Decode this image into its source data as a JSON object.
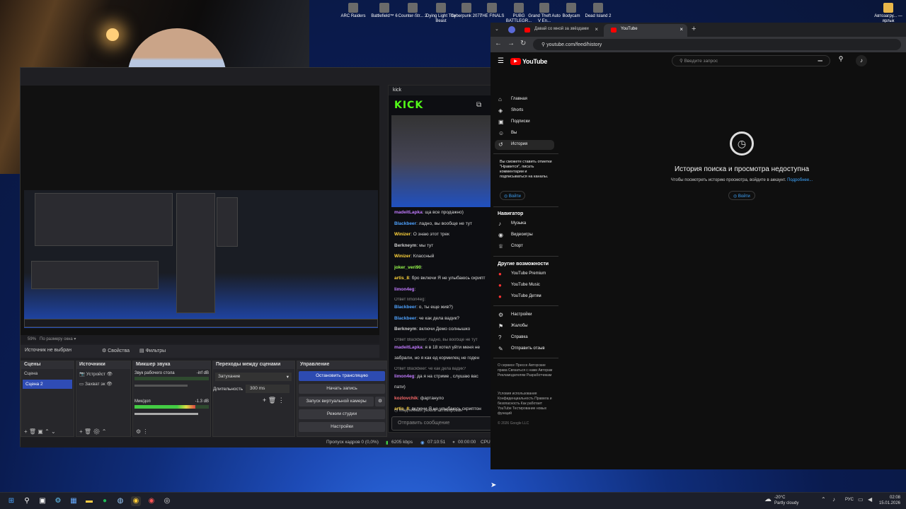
{
  "desktop_icons": [
    {
      "label": "ARC Raiders",
      "icon": "game-icon"
    },
    {
      "label": "Battlefield™ 6",
      "icon": "game-icon"
    },
    {
      "label": "Counter-Str... 2",
      "icon": "game-icon"
    },
    {
      "label": "Dying Light The Beast",
      "icon": "game-icon"
    },
    {
      "label": "Cyberpunk 2077",
      "icon": "game-icon"
    },
    {
      "label": "THE FINALS",
      "icon": "game-icon"
    },
    {
      "label": "PUBG BATTLEGR...",
      "icon": "game-icon"
    },
    {
      "label": "Grand Theft Auto V En...",
      "icon": "game-icon"
    },
    {
      "label": "Bodycam",
      "icon": "game-icon"
    },
    {
      "label": "Dead Island 2",
      "icon": "game-icon"
    },
    {
      "label": "Автозагру... — ярлык",
      "icon": "folder-icon"
    }
  ],
  "obs": {
    "zoom": "59%",
    "zoom_mode": "По размеру окна",
    "no_source": "Источник не выбран",
    "properties": "Свойства",
    "filters": "Фильтры",
    "scenes": {
      "title": "Сцены",
      "items": [
        "Сцена",
        "Сцена 2"
      ],
      "selected": 1
    },
    "sources": {
      "title": "Источники",
      "items": [
        "Устройст",
        "Захват эк"
      ]
    },
    "mixer": {
      "title": "Микшер звука",
      "channels": [
        {
          "name": "Звук рабочего стола",
          "db": "-inf dB",
          "level": 0.0
        },
        {
          "name": "Мик/доп",
          "db": "-1.3 dB",
          "level": 0.82
        }
      ]
    },
    "transitions": {
      "title": "Переходы между сценами",
      "type": "Затухание",
      "duration_label": "Длительность",
      "duration": "300 ms"
    },
    "controls": {
      "title": "Управление",
      "buttons": [
        "Остановить трансляцию",
        "Начать запись",
        "Запуск виртуальной камеры",
        "Режим студии",
        "Настройки"
      ]
    },
    "status": {
      "dropped": "Пропуск кадров 0 (0,0%)",
      "bitrate": "6205 kbps",
      "stream_time": "07:10:51",
      "rec_time": "00:00:00",
      "cpu": "CPU:"
    }
  },
  "kick": {
    "title": "kick",
    "logo": "KICK",
    "messages": [
      {
        "user": "madeitLapka",
        "text": "ща все продажно)",
        "color": "#c27bff"
      },
      {
        "user": "Blackbeer",
        "text": "ладно, вы вообще не тут",
        "color": "#4fa3ff"
      },
      {
        "user": "Winizer",
        "text": "О знаю этот трек",
        "color": "#ffd43b"
      },
      {
        "user": "Berkneym",
        "text": "мы тут",
        "color": "#cfcfcf"
      },
      {
        "user": "Winizer",
        "text": "Классный",
        "color": "#ffd43b"
      },
      {
        "user": "joker_veri90",
        "text": "",
        "color": "#9bff4f"
      },
      {
        "user": "artis_8",
        "text": "бро включи Я не улыбаюсь скрипт",
        "color": "#ffd43b"
      },
      {
        "user": "limon4eg",
        "text": "",
        "color": "#c27bff"
      },
      {
        "reply": "Ответ limon4eg:"
      },
      {
        "user": "Blackbeer",
        "text": "о, ты еще жив?)",
        "color": "#4fa3ff"
      },
      {
        "user": "Blackbeer",
        "text": "че как дела вадик?",
        "color": "#4fa3ff"
      },
      {
        "user": "Berkneym",
        "text": "включи Демо солнышко",
        "color": "#cfcfcf"
      },
      {
        "reply": "Ответ Blackbeer: ладно, вы вообще не тут"
      },
      {
        "user": "madeitLapka",
        "text": "я в 18 хотел уйти меня не",
        "color": "#c27bff"
      },
      {
        "text": "забрали, но я как ед кормилец не годен"
      },
      {
        "reply": "Ответ Blackbeer: че как дела вадик?"
      },
      {
        "user": "limon4eg",
        "text": "да я на стриме , слушаю вас",
        "color": "#c27bff"
      },
      {
        "text": "пати)"
      },
      {
        "user": "kozlovchik",
        "text": "фартануло",
        "color": "#ff6b6b"
      },
      {
        "user": "artis_8",
        "text": "включи Я не улыбаюсь скриптон",
        "color": "#ffd43b"
      }
    ],
    "slow_mode": "Медленный режим активирован",
    "input_placeholder": "Отправить сообщение"
  },
  "chrome": {
    "tabs": [
      {
        "title": "Давай со мной за звёздами"
      },
      {
        "title": "YouTube"
      }
    ],
    "url": "youtube.com/feed/history"
  },
  "youtube": {
    "search_placeholder": "Введите запрос",
    "nav": [
      "Главная",
      "Shorts",
      "Подписки",
      "Вы",
      "История"
    ],
    "signin_prompt": "Вы сможете ставить отметки \"Нравится\", писать комментарии и подписываться на каналы.",
    "signin": "Войти",
    "navigator_title": "Навигатор",
    "navigator": [
      "Музыка",
      "Видеоигры",
      "Спорт"
    ],
    "more_title": "Другие возможности",
    "more": [
      "YouTube Premium",
      "YouTube Music",
      "YouTube Детям"
    ],
    "settings_items": [
      "Настройки",
      "Жалобы",
      "Справка",
      "Отправить отзыв"
    ],
    "footer1": "О сервисе  Прессе  Авторские права  Связаться с нами  Авторам  Рекламодателям  Разработчикам",
    "footer2": "Условия использования  Конфиденциальность  Правила и безопасность  Как работает YouTube  Тестирование новых функций",
    "copyright": "© 2026 Google LLC",
    "history_title": "История поиска и просмотра недоступна",
    "history_sub": "Чтобы посмотреть историю просмотра, войдите в аккаунт.",
    "history_more": "Подробнее...",
    "history_signin": "Войти"
  },
  "taskbar": {
    "weather_temp": "-20°C",
    "weather_text": "Partly cloudy",
    "lang": "РУС",
    "time": "02:08",
    "date": "15.01.2026"
  }
}
